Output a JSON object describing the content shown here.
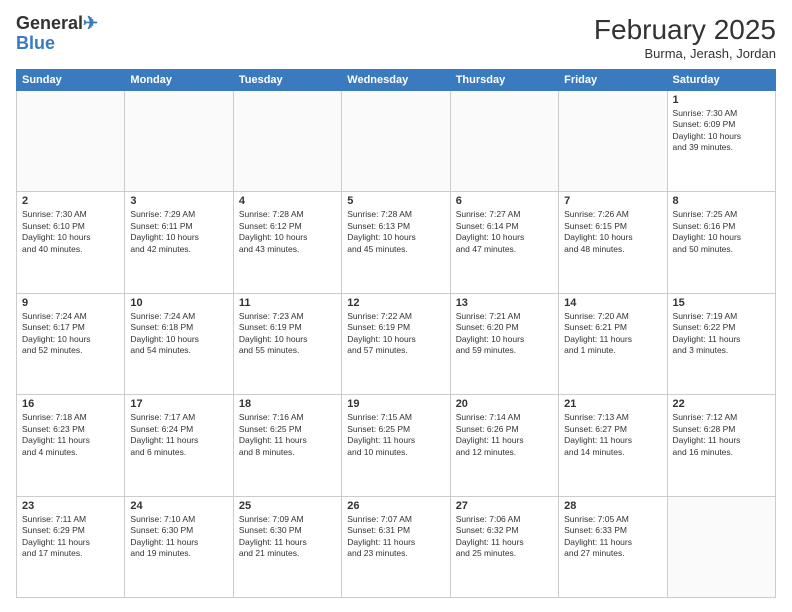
{
  "header": {
    "logo": {
      "general": "General",
      "blue": "Blue"
    },
    "title": "February 2025",
    "subtitle": "Burma, Jerash, Jordan"
  },
  "calendar": {
    "weekdays": [
      "Sunday",
      "Monday",
      "Tuesday",
      "Wednesday",
      "Thursday",
      "Friday",
      "Saturday"
    ],
    "weeks": [
      [
        {
          "day": "",
          "info": ""
        },
        {
          "day": "",
          "info": ""
        },
        {
          "day": "",
          "info": ""
        },
        {
          "day": "",
          "info": ""
        },
        {
          "day": "",
          "info": ""
        },
        {
          "day": "",
          "info": ""
        },
        {
          "day": "1",
          "info": "Sunrise: 7:30 AM\nSunset: 6:09 PM\nDaylight: 10 hours\nand 39 minutes."
        }
      ],
      [
        {
          "day": "2",
          "info": "Sunrise: 7:30 AM\nSunset: 6:10 PM\nDaylight: 10 hours\nand 40 minutes."
        },
        {
          "day": "3",
          "info": "Sunrise: 7:29 AM\nSunset: 6:11 PM\nDaylight: 10 hours\nand 42 minutes."
        },
        {
          "day": "4",
          "info": "Sunrise: 7:28 AM\nSunset: 6:12 PM\nDaylight: 10 hours\nand 43 minutes."
        },
        {
          "day": "5",
          "info": "Sunrise: 7:28 AM\nSunset: 6:13 PM\nDaylight: 10 hours\nand 45 minutes."
        },
        {
          "day": "6",
          "info": "Sunrise: 7:27 AM\nSunset: 6:14 PM\nDaylight: 10 hours\nand 47 minutes."
        },
        {
          "day": "7",
          "info": "Sunrise: 7:26 AM\nSunset: 6:15 PM\nDaylight: 10 hours\nand 48 minutes."
        },
        {
          "day": "8",
          "info": "Sunrise: 7:25 AM\nSunset: 6:16 PM\nDaylight: 10 hours\nand 50 minutes."
        }
      ],
      [
        {
          "day": "9",
          "info": "Sunrise: 7:24 AM\nSunset: 6:17 PM\nDaylight: 10 hours\nand 52 minutes."
        },
        {
          "day": "10",
          "info": "Sunrise: 7:24 AM\nSunset: 6:18 PM\nDaylight: 10 hours\nand 54 minutes."
        },
        {
          "day": "11",
          "info": "Sunrise: 7:23 AM\nSunset: 6:19 PM\nDaylight: 10 hours\nand 55 minutes."
        },
        {
          "day": "12",
          "info": "Sunrise: 7:22 AM\nSunset: 6:19 PM\nDaylight: 10 hours\nand 57 minutes."
        },
        {
          "day": "13",
          "info": "Sunrise: 7:21 AM\nSunset: 6:20 PM\nDaylight: 10 hours\nand 59 minutes."
        },
        {
          "day": "14",
          "info": "Sunrise: 7:20 AM\nSunset: 6:21 PM\nDaylight: 11 hours\nand 1 minute."
        },
        {
          "day": "15",
          "info": "Sunrise: 7:19 AM\nSunset: 6:22 PM\nDaylight: 11 hours\nand 3 minutes."
        }
      ],
      [
        {
          "day": "16",
          "info": "Sunrise: 7:18 AM\nSunset: 6:23 PM\nDaylight: 11 hours\nand 4 minutes."
        },
        {
          "day": "17",
          "info": "Sunrise: 7:17 AM\nSunset: 6:24 PM\nDaylight: 11 hours\nand 6 minutes."
        },
        {
          "day": "18",
          "info": "Sunrise: 7:16 AM\nSunset: 6:25 PM\nDaylight: 11 hours\nand 8 minutes."
        },
        {
          "day": "19",
          "info": "Sunrise: 7:15 AM\nSunset: 6:25 PM\nDaylight: 11 hours\nand 10 minutes."
        },
        {
          "day": "20",
          "info": "Sunrise: 7:14 AM\nSunset: 6:26 PM\nDaylight: 11 hours\nand 12 minutes."
        },
        {
          "day": "21",
          "info": "Sunrise: 7:13 AM\nSunset: 6:27 PM\nDaylight: 11 hours\nand 14 minutes."
        },
        {
          "day": "22",
          "info": "Sunrise: 7:12 AM\nSunset: 6:28 PM\nDaylight: 11 hours\nand 16 minutes."
        }
      ],
      [
        {
          "day": "23",
          "info": "Sunrise: 7:11 AM\nSunset: 6:29 PM\nDaylight: 11 hours\nand 17 minutes."
        },
        {
          "day": "24",
          "info": "Sunrise: 7:10 AM\nSunset: 6:30 PM\nDaylight: 11 hours\nand 19 minutes."
        },
        {
          "day": "25",
          "info": "Sunrise: 7:09 AM\nSunset: 6:30 PM\nDaylight: 11 hours\nand 21 minutes."
        },
        {
          "day": "26",
          "info": "Sunrise: 7:07 AM\nSunset: 6:31 PM\nDaylight: 11 hours\nand 23 minutes."
        },
        {
          "day": "27",
          "info": "Sunrise: 7:06 AM\nSunset: 6:32 PM\nDaylight: 11 hours\nand 25 minutes."
        },
        {
          "day": "28",
          "info": "Sunrise: 7:05 AM\nSunset: 6:33 PM\nDaylight: 11 hours\nand 27 minutes."
        },
        {
          "day": "",
          "info": ""
        }
      ]
    ]
  }
}
